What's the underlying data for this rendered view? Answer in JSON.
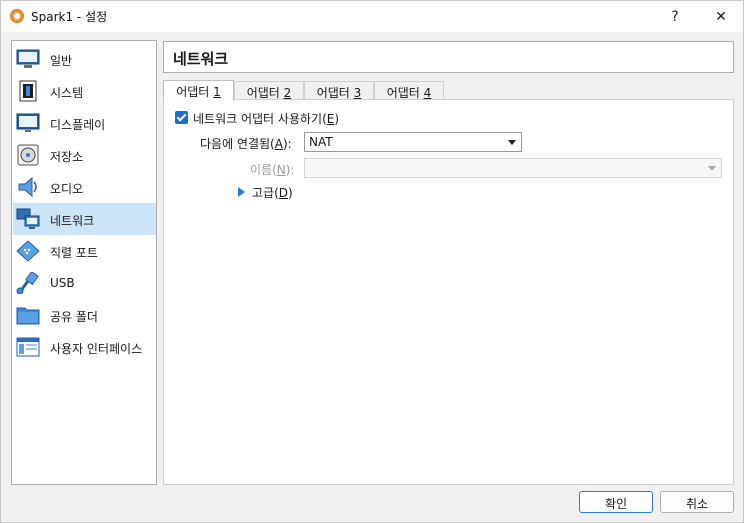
{
  "window": {
    "title": "Spark1 - 설정",
    "help_label": "?",
    "close_label": "✕"
  },
  "sidebar": {
    "items": [
      {
        "label": "일반",
        "icon": "monitor-icon"
      },
      {
        "label": "시스템",
        "icon": "chip-icon"
      },
      {
        "label": "디스플레이",
        "icon": "display-icon"
      },
      {
        "label": "저장소",
        "icon": "disk-icon"
      },
      {
        "label": "오디오",
        "icon": "speaker-icon"
      },
      {
        "label": "네트워크",
        "icon": "network-icon"
      },
      {
        "label": "직렬 포트",
        "icon": "serial-port-icon"
      },
      {
        "label": "USB",
        "icon": "usb-icon"
      },
      {
        "label": "공유 폴더",
        "icon": "folder-icon"
      },
      {
        "label": "사용자 인터페이스",
        "icon": "window-icon"
      }
    ],
    "active_index": 5
  },
  "main": {
    "title": "네트워크",
    "tabs": [
      {
        "label": "어댑터 ",
        "num": "1"
      },
      {
        "label": "어댑터 ",
        "num": "2"
      },
      {
        "label": "어댑터 ",
        "num": "3"
      },
      {
        "label": "어댑터 ",
        "num": "4"
      }
    ],
    "enable": {
      "label": "네트워크 어댑터 사용하기(",
      "key": "E",
      "suffix": ")",
      "checked": true
    },
    "attached": {
      "label_prefix": "다음에 연결됨(",
      "key": "A",
      "label_suffix": "):",
      "value": "NAT"
    },
    "name": {
      "label_prefix": "이름(",
      "key": "N",
      "label_suffix": "):",
      "value": ""
    },
    "advanced": {
      "label_prefix": "고급(",
      "key": "D",
      "label_suffix": ")"
    }
  },
  "buttons": {
    "ok": "확인",
    "cancel": "취소"
  },
  "colors": {
    "accent": "#2a7bd4",
    "selection": "#cce4f7"
  }
}
